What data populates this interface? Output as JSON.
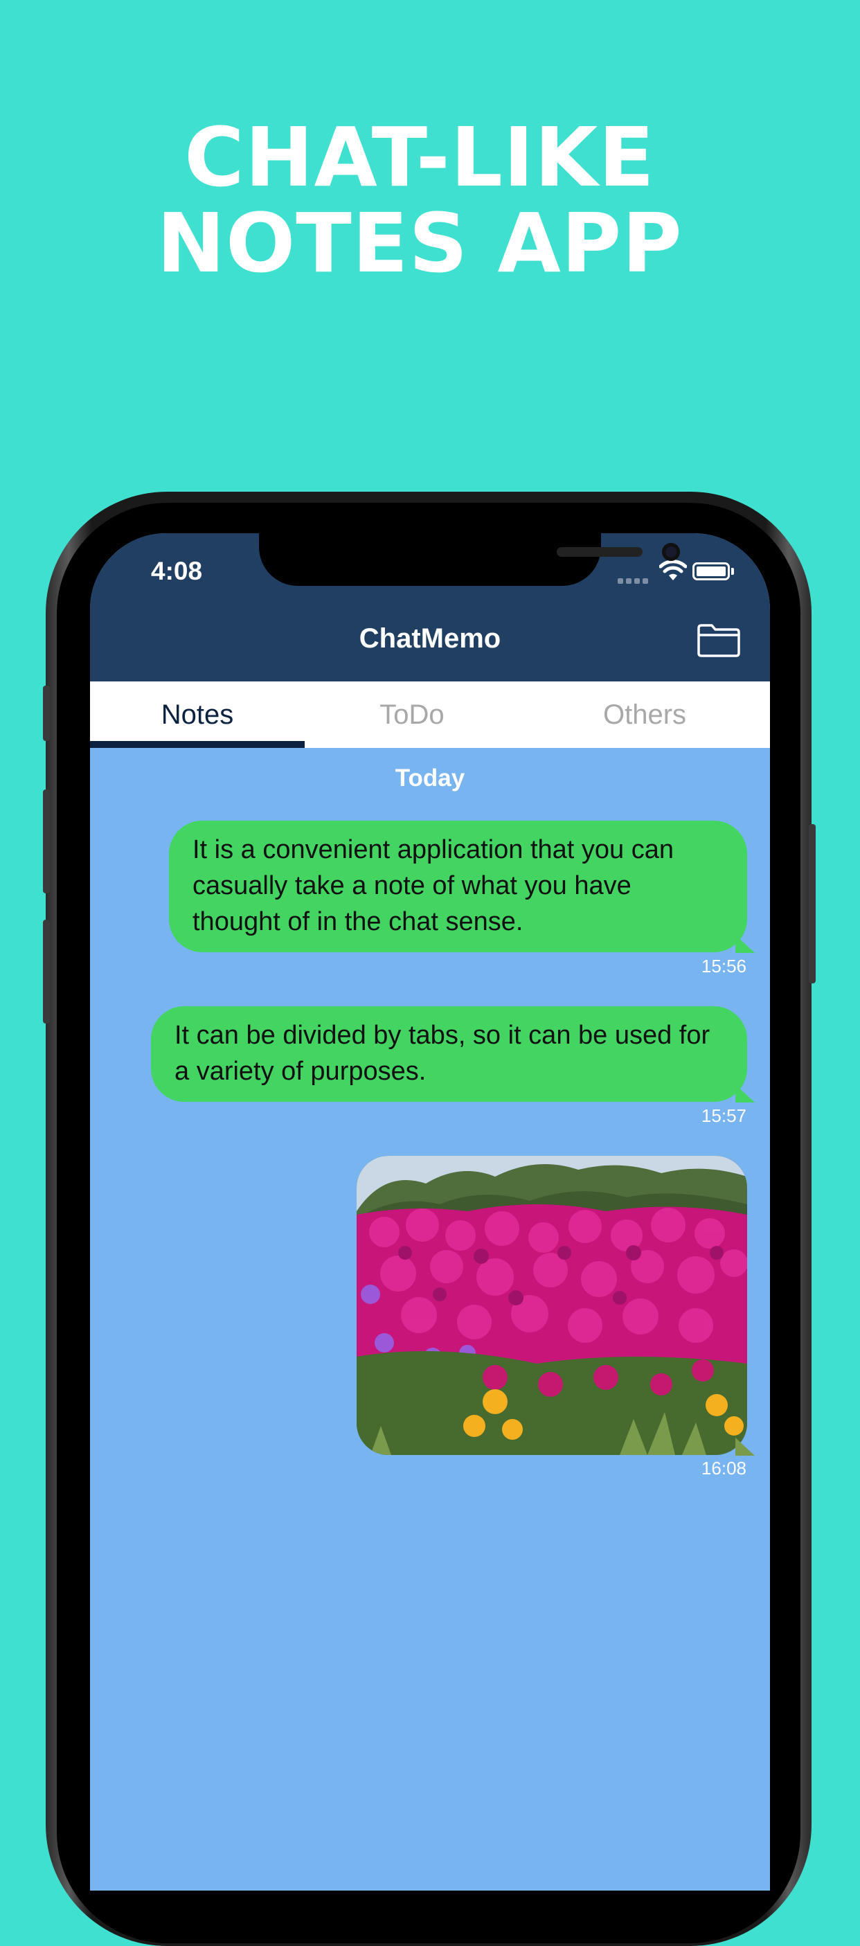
{
  "headline": {
    "line1": "CHAT-LIKE",
    "line2": "NOTES APP"
  },
  "status_bar": {
    "time": "4:08"
  },
  "app": {
    "title": "ChatMemo"
  },
  "tabs": [
    {
      "label": "Notes",
      "active": true
    },
    {
      "label": "ToDo",
      "active": false
    },
    {
      "label": "Others",
      "active": false
    }
  ],
  "chat": {
    "date_separator": "Today",
    "messages": [
      {
        "text": "It is a convenient application that you can casually take a note of what you have thought of in the chat sense.",
        "time": "15:56"
      },
      {
        "text": "It can be divided by tabs, so it can be used for a variety of purposes.",
        "time": "15:57"
      },
      {
        "image": "flower-photo",
        "time": "16:08"
      }
    ]
  },
  "colors": {
    "background": "#40e0d0",
    "header": "#213f63",
    "chat_background": "#78b4f0",
    "bubble": "#44d462",
    "tab_active": "#0d2240",
    "tab_inactive": "#a8a8a8"
  }
}
